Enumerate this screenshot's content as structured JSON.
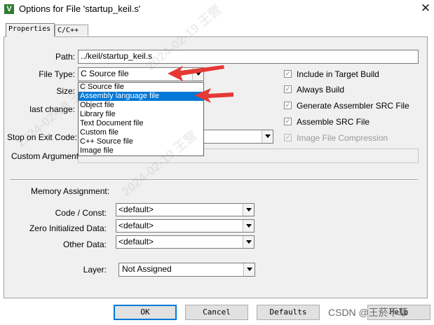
{
  "window": {
    "icon_letter": "V",
    "title": "Options for File 'startup_keil.s'",
    "close_glyph": "✕"
  },
  "tabs": [
    {
      "label": "Properties",
      "active": true
    },
    {
      "label": "C/C++",
      "active": false
    }
  ],
  "form": {
    "path_label": "Path:",
    "path_value": "../keil/startup_keil.s",
    "file_type_label": "File Type:",
    "file_type_value": "C Source file",
    "size_label": "Size:",
    "last_change_label": "last change:",
    "stop_on_exit_label": "Stop on Exit Code:",
    "custom_args_label": "Custom Arguments:"
  },
  "file_type_options": [
    {
      "label": "C Source file",
      "selected": false
    },
    {
      "label": "Assembly language file",
      "selected": true
    },
    {
      "label": "Object file",
      "selected": false
    },
    {
      "label": "Library file",
      "selected": false
    },
    {
      "label": "Text Document file",
      "selected": false
    },
    {
      "label": "Custom file",
      "selected": false
    },
    {
      "label": "C++ Source file",
      "selected": false
    },
    {
      "label": "Image file",
      "selected": false
    }
  ],
  "checkboxes": [
    {
      "label": "Include in Target Build",
      "checked": true,
      "enabled": true
    },
    {
      "label": "Always Build",
      "checked": true,
      "enabled": true
    },
    {
      "label": "Generate Assembler SRC File",
      "checked": true,
      "enabled": true
    },
    {
      "label": "Assemble SRC File",
      "checked": true,
      "enabled": true
    },
    {
      "label": "Image File Compression",
      "checked": true,
      "enabled": false
    }
  ],
  "memory": {
    "section_label": "Memory Assignment:",
    "code_const_label": "Code / Const:",
    "code_const_value": "<default>",
    "zero_init_label": "Zero Initialized Data:",
    "zero_init_value": "<default>",
    "other_data_label": "Other Data:",
    "other_data_value": "<default>",
    "layer_label": "Layer:",
    "layer_value": "Not Assigned"
  },
  "buttons": {
    "ok": "OK",
    "cancel": "Cancel",
    "defaults": "Defaults",
    "help": "Help"
  },
  "watermarks": {
    "diag_1": "2024-02-19 王营",
    "diag_2": "2024-02-19 王营",
    "diag_3": "2024-02-19 王营",
    "csdn": "CSDN @王菸不草"
  },
  "colors": {
    "selection": "#0078d7",
    "annotation_arrow": "#e53935",
    "dialog_bg": "#f0f0f0"
  }
}
